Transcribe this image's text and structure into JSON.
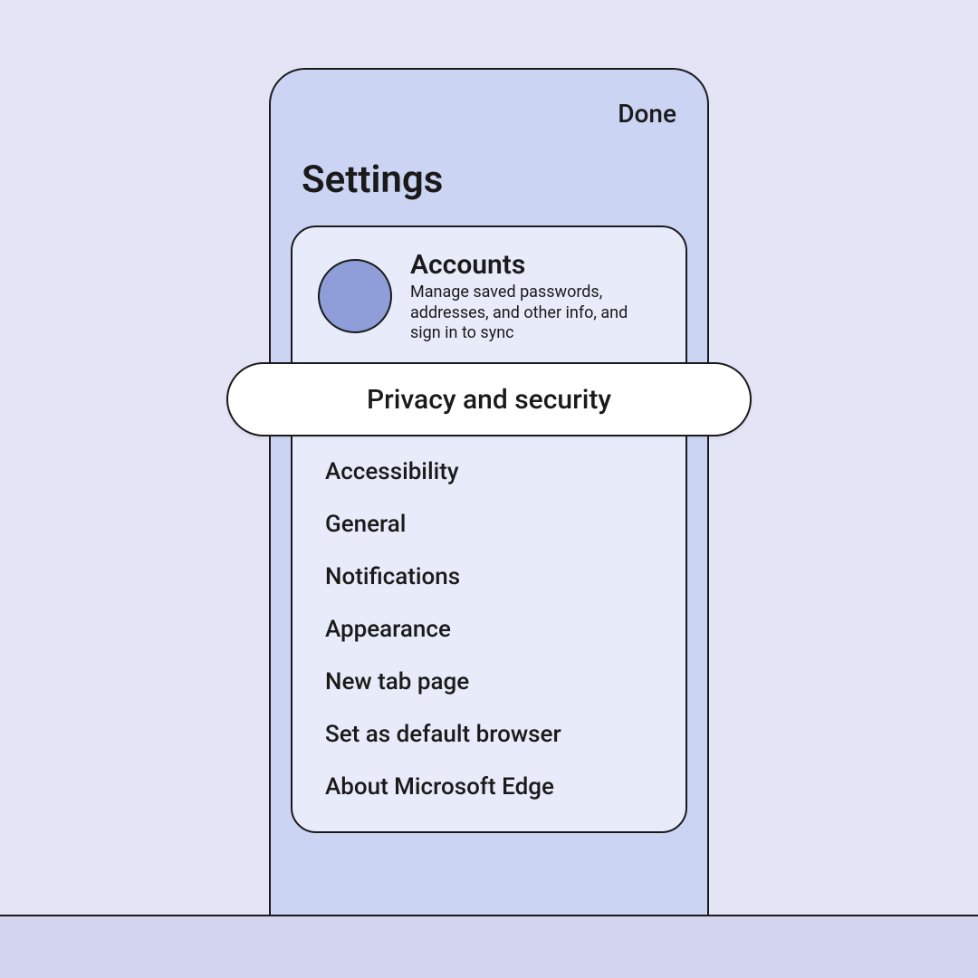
{
  "header": {
    "done_label": "Done",
    "title": "Settings"
  },
  "accounts": {
    "title": "Accounts",
    "description": "Manage saved passwords, addresses, and other info, and sign in to sync"
  },
  "highlighted_item": {
    "label": "Privacy and security"
  },
  "menu": {
    "items": [
      {
        "label": "Accessibility"
      },
      {
        "label": "General"
      },
      {
        "label": "Notifications"
      },
      {
        "label": "Appearance"
      },
      {
        "label": "New tab page"
      },
      {
        "label": "Set as default browser"
      },
      {
        "label": "About Microsoft Edge"
      }
    ]
  }
}
